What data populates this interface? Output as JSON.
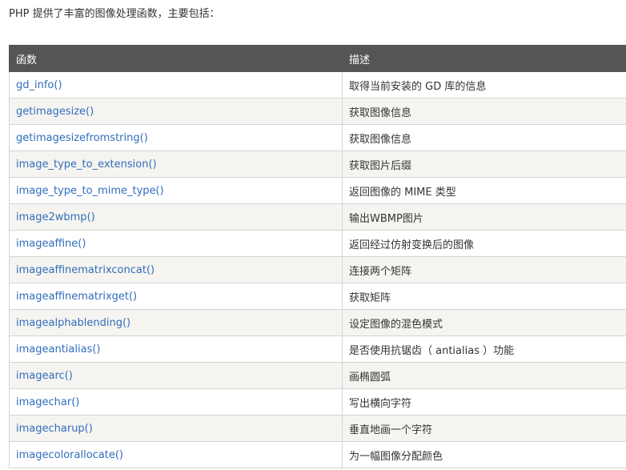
{
  "intro": "PHP 提供了丰富的图像处理函数，主要包括：",
  "table": {
    "headers": [
      "函数",
      "描述"
    ],
    "rows": [
      {
        "fn": "gd_info()",
        "desc": "取得当前安装的 GD 库的信息"
      },
      {
        "fn": "getimagesize()",
        "desc": "获取图像信息"
      },
      {
        "fn": "getimagesizefromstring()",
        "desc": "获取图像信息"
      },
      {
        "fn": "image_type_to_extension()",
        "desc": "获取图片后缀"
      },
      {
        "fn": "image_type_to_mime_type()",
        "desc": "返回图像的 MIME 类型"
      },
      {
        "fn": "image2wbmp()",
        "desc": "输出WBMP图片"
      },
      {
        "fn": "imageaffine()",
        "desc": "返回经过仿射变换后的图像"
      },
      {
        "fn": "imageaffinematrixconcat()",
        "desc": "连接两个矩阵"
      },
      {
        "fn": "imageaffinematrixget()",
        "desc": "获取矩阵"
      },
      {
        "fn": "imagealphablending()",
        "desc": "设定图像的混色模式"
      },
      {
        "fn": "imageantialias()",
        "desc": "是否使用抗锯齿（ antialias ）功能"
      },
      {
        "fn": "imagearc()",
        "desc": "画椭圆弧"
      },
      {
        "fn": "imagechar()",
        "desc": "写出横向字符"
      },
      {
        "fn": "imagecharup()",
        "desc": "垂直地画一个字符"
      },
      {
        "fn": "imagecolorallocate()",
        "desc": "为一幅图像分配颜色"
      }
    ]
  }
}
